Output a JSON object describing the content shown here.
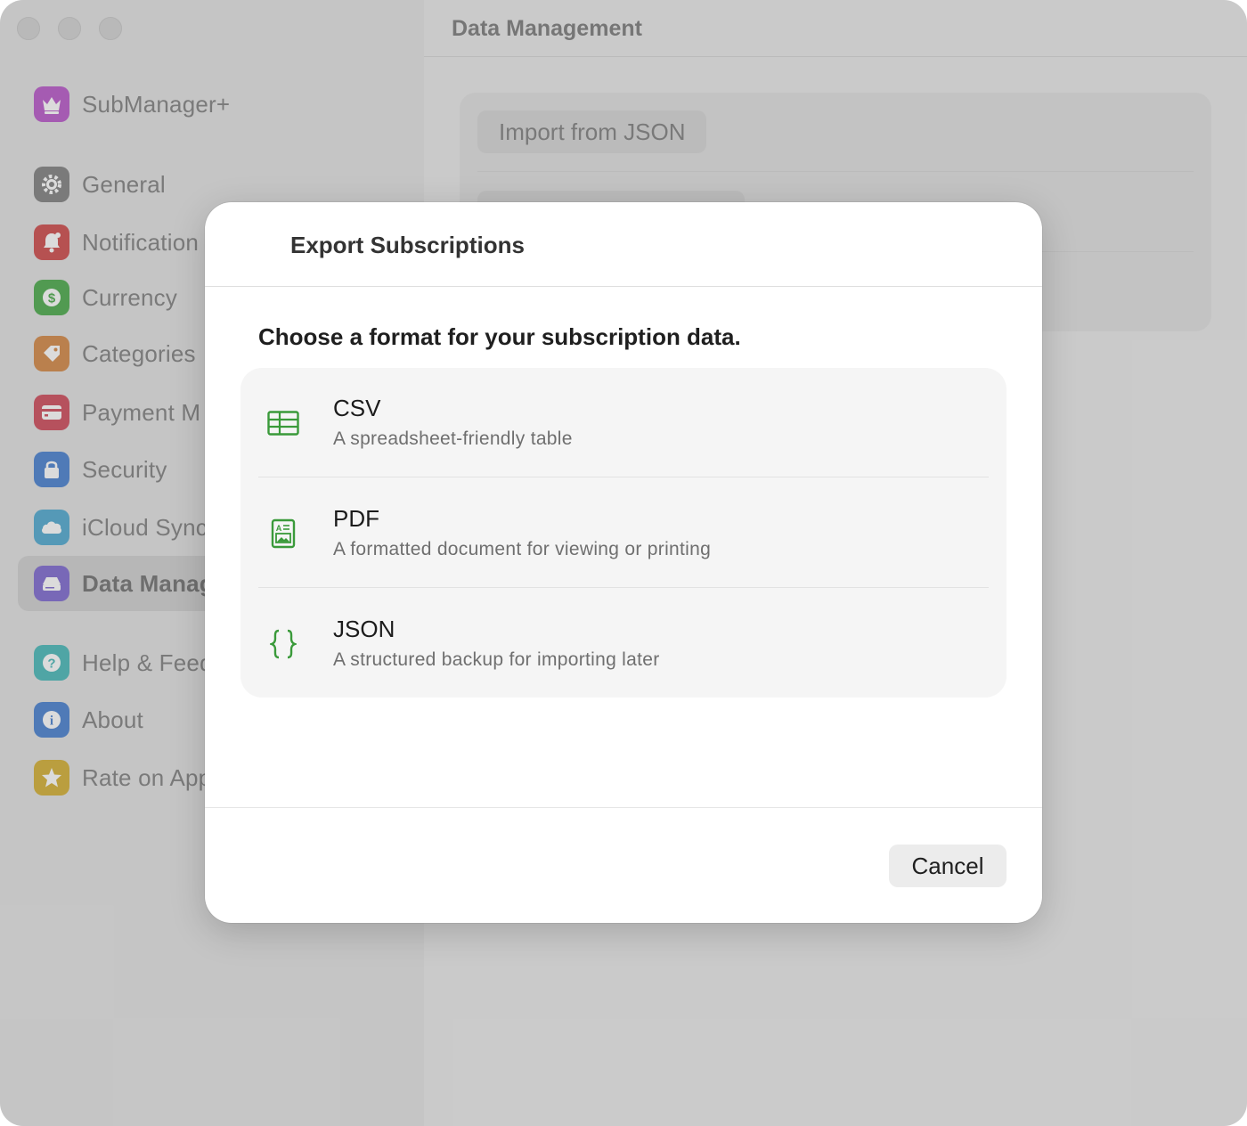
{
  "app": {
    "name": "SubManager+",
    "icon": "crown-icon"
  },
  "window": {
    "title": "Data Management"
  },
  "sidebar": {
    "items": [
      {
        "label": "General",
        "icon": "gear-icon",
        "color": "#8e8e8e"
      },
      {
        "label": "Notification",
        "icon": "bell-icon",
        "color": "#d45f5f"
      },
      {
        "label": "Currency",
        "icon": "dollar-icon",
        "color": "#5fb45f"
      },
      {
        "label": "Categories",
        "icon": "tag-icon",
        "color": "#d9955a"
      },
      {
        "label": "Payment M",
        "icon": "credit-card-icon",
        "color": "#d45f6d"
      },
      {
        "label": "Security",
        "icon": "lock-icon",
        "color": "#5c8fd6"
      },
      {
        "label": "iCloud Sync",
        "icon": "cloud-icon",
        "color": "#63b3d6"
      },
      {
        "label": "Data Manag",
        "icon": "drive-icon",
        "color": "#8c7ad6",
        "selected": true
      },
      {
        "label": "Help & Feed",
        "icon": "question-icon",
        "color": "#5cc0c0"
      },
      {
        "label": "About",
        "icon": "info-icon",
        "color": "#5c8fd6"
      },
      {
        "label": "Rate on App",
        "icon": "star-icon",
        "color": "#d9b84a"
      }
    ]
  },
  "main": {
    "import_button_label": "Import from JSON"
  },
  "dialog": {
    "title": "Export Subscriptions",
    "prompt": "Choose a format for your subscription data.",
    "accent_color": "#3a9a3a",
    "options": [
      {
        "name": "CSV",
        "description": "A spreadsheet-friendly table",
        "icon": "table-icon"
      },
      {
        "name": "PDF",
        "description": "A formatted document for viewing or printing",
        "icon": "document-icon"
      },
      {
        "name": "JSON",
        "description": "A structured backup for importing later",
        "icon": "braces-icon"
      }
    ],
    "cancel_label": "Cancel"
  }
}
